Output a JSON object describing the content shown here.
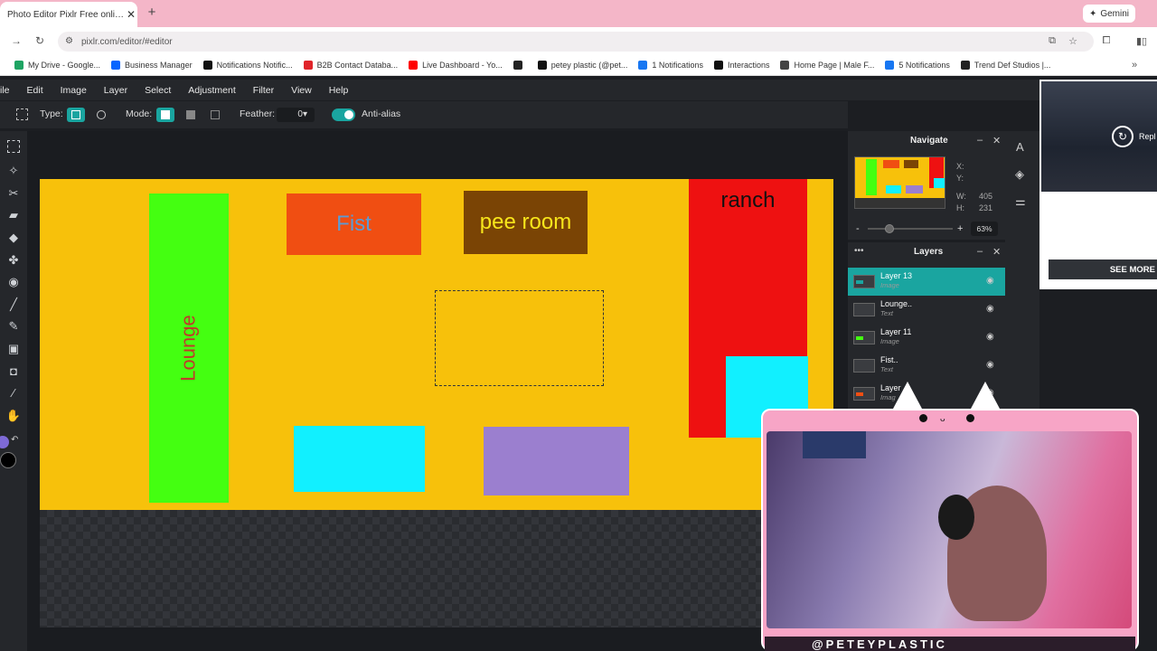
{
  "browser": {
    "tab_title": "Photo Editor Pixlr Free online In",
    "new_tab": "+",
    "gemini_label": "Gemini",
    "url": "pixlr.com/editor/#editor",
    "bookmarks": [
      {
        "label": "My Drive - Google...",
        "color": "#1fa463"
      },
      {
        "label": "Business Manager",
        "color": "#0866ff"
      },
      {
        "label": "Notifications Notific...",
        "color": "#111111"
      },
      {
        "label": "B2B Contact Databa...",
        "color": "#e0242a"
      },
      {
        "label": "Live Dashboard - Yo...",
        "color": "#ff0000"
      },
      {
        "label": "",
        "color": "#222222"
      },
      {
        "label": "petey plastic (@pet...",
        "color": "#111111"
      },
      {
        "label": "1 Notifications",
        "color": "#1877f2"
      },
      {
        "label": "Interactions",
        "color": "#111111"
      },
      {
        "label": "Home Page | Male F...",
        "color": "#444444"
      },
      {
        "label": "5 Notifications",
        "color": "#1877f2"
      },
      {
        "label": "Trend Def Studios |...",
        "color": "#222222"
      }
    ]
  },
  "menu": [
    "ile",
    "Edit",
    "Image",
    "Layer",
    "Select",
    "Adjustment",
    "Filter",
    "View",
    "Help"
  ],
  "options": {
    "type_label": "Type:",
    "mode_label": "Mode:",
    "feather_label": "Feather:",
    "feather_value": "0",
    "antialias_label": "Anti-alias"
  },
  "canvas": {
    "background": "#f7c10b",
    "rooms": [
      {
        "name": "lounge",
        "label": "Lounge",
        "color": "#44ff11",
        "text_color": "#c0392b"
      },
      {
        "name": "fist",
        "label": "Fist",
        "color": "#f04e12",
        "text_color": "#5b9bd5"
      },
      {
        "name": "pee-room",
        "label": "pee room",
        "color": "#7a4405",
        "text_color": "#f7e51b"
      },
      {
        "name": "ranch",
        "label": "ranch",
        "color": "#ee1111",
        "text_color": "#111111"
      },
      {
        "name": "cyan-room-a",
        "label": "",
        "color": "#11f0ff"
      },
      {
        "name": "purple-room",
        "label": "",
        "color": "#9b7fcf"
      },
      {
        "name": "cyan-room-b",
        "label": "",
        "color": "#11f0ff"
      }
    ]
  },
  "navigate": {
    "title": "Navigate",
    "x_label": "X:",
    "y_label": "Y:",
    "w_label": "W:",
    "w_value": "405",
    "h_label": "H:",
    "h_value": "231",
    "zoom": "63%",
    "zoom_fraction": 0.63,
    "minus": "-",
    "plus": "+"
  },
  "layers": {
    "title": "Layers",
    "items": [
      {
        "name": "Layer 13",
        "type": "Image",
        "selected": true
      },
      {
        "name": "Lounge..",
        "type": "Text",
        "selected": false
      },
      {
        "name": "Layer 11",
        "type": "Image",
        "selected": false
      },
      {
        "name": "Fist..",
        "type": "Text",
        "selected": false
      },
      {
        "name": "Layer",
        "type": "Imag",
        "selected": false
      }
    ]
  },
  "ad": {
    "replay_label": "Repl",
    "cta": "SEE MORE"
  },
  "stream": {
    "handle": "@PETEYPLASTIC"
  },
  "colors": {
    "accent": "#1aa5a0",
    "panel": "#25272b"
  }
}
